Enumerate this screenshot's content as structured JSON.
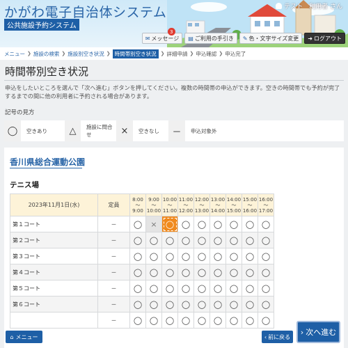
{
  "header": {
    "site_title": "かがわ電子自治体システム",
    "sub_title": "公共施設予約システム",
    "user_name": "テスト　利用者 さん",
    "buttons": {
      "message": "メッセージ",
      "message_count": "3",
      "guide": "ご利用の手引き",
      "color_size": "色・文字サイズ変更",
      "logout": "ログアウト"
    }
  },
  "breadcrumb": [
    "メニュー",
    "施設の検索",
    "施設別空き状況",
    "時間帯別空き状況",
    "詳細申請",
    "申込確認",
    "申込完了"
  ],
  "page_title": "時間帯別空き状況",
  "intro": "申込をしたいところを選んで「次へ進む」ボタンを押してください。複数の時間帯の申込ができます。空きの時間帯でも予約が完了するまでの間に他の利用者に予約される場合があります。",
  "legend": {
    "title": "記号の見方",
    "items": [
      {
        "symbol": "◯",
        "label": "空きあり"
      },
      {
        "symbol": "△",
        "label": "施設に問合せ"
      },
      {
        "symbol": "×",
        "label": "空きなし"
      },
      {
        "symbol": "－",
        "label": "申込対象外"
      }
    ]
  },
  "facility": {
    "name": "香川県総合運動公園",
    "place": "テニス場",
    "date_header": "2023年11月1日(水)",
    "capacity_header": "定員",
    "slots": [
      {
        "from": "8:00",
        "to": "9:00"
      },
      {
        "from": "9:00",
        "to": "10:00"
      },
      {
        "from": "10:00",
        "to": "11:00"
      },
      {
        "from": "11:00",
        "to": "12:00"
      },
      {
        "from": "12:00",
        "to": "13:00"
      },
      {
        "from": "13:00",
        "to": "14:00"
      },
      {
        "from": "14:00",
        "to": "15:00"
      },
      {
        "from": "15:00",
        "to": "16:00"
      },
      {
        "from": "16:00",
        "to": "17:00"
      }
    ],
    "tilde": "〜",
    "rows": [
      {
        "name": "第１コート",
        "capacity": "－",
        "status": [
          "◯",
          "×",
          "◯",
          "◯",
          "◯",
          "◯",
          "◯",
          "◯",
          "◯"
        ]
      },
      {
        "name": "第２コート",
        "capacity": "－",
        "status": [
          "◯",
          "◯",
          "◯",
          "◯",
          "◯",
          "◯",
          "◯",
          "◯",
          "◯"
        ]
      },
      {
        "name": "第３コート",
        "capacity": "－",
        "status": [
          "◯",
          "◯",
          "◯",
          "◯",
          "◯",
          "◯",
          "◯",
          "◯",
          "◯"
        ]
      },
      {
        "name": "第４コート",
        "capacity": "－",
        "status": [
          "◯",
          "◯",
          "◯",
          "◯",
          "◯",
          "◯",
          "◯",
          "◯",
          "◯"
        ]
      },
      {
        "name": "第５コート",
        "capacity": "－",
        "status": [
          "◯",
          "◯",
          "◯",
          "◯",
          "◯",
          "◯",
          "◯",
          "◯",
          "◯"
        ]
      },
      {
        "name": "第６コート",
        "capacity": "－",
        "status": [
          "◯",
          "◯",
          "◯",
          "◯",
          "◯",
          "◯",
          "◯",
          "◯",
          "◯"
        ]
      },
      {
        "name": "",
        "capacity": "－",
        "status": [
          "◯",
          "◯",
          "◯",
          "◯",
          "◯",
          "◯",
          "◯",
          "◯",
          "◯"
        ]
      }
    ],
    "selected": {
      "row": 0,
      "slot": 2
    }
  },
  "footer": {
    "menu": "メニュー",
    "back": "前に戻る",
    "next": "次へ進む"
  },
  "colors": {
    "primary": "#1e5fa6",
    "selected": "#f08a1e",
    "header_cell": "#fdf3d8"
  }
}
